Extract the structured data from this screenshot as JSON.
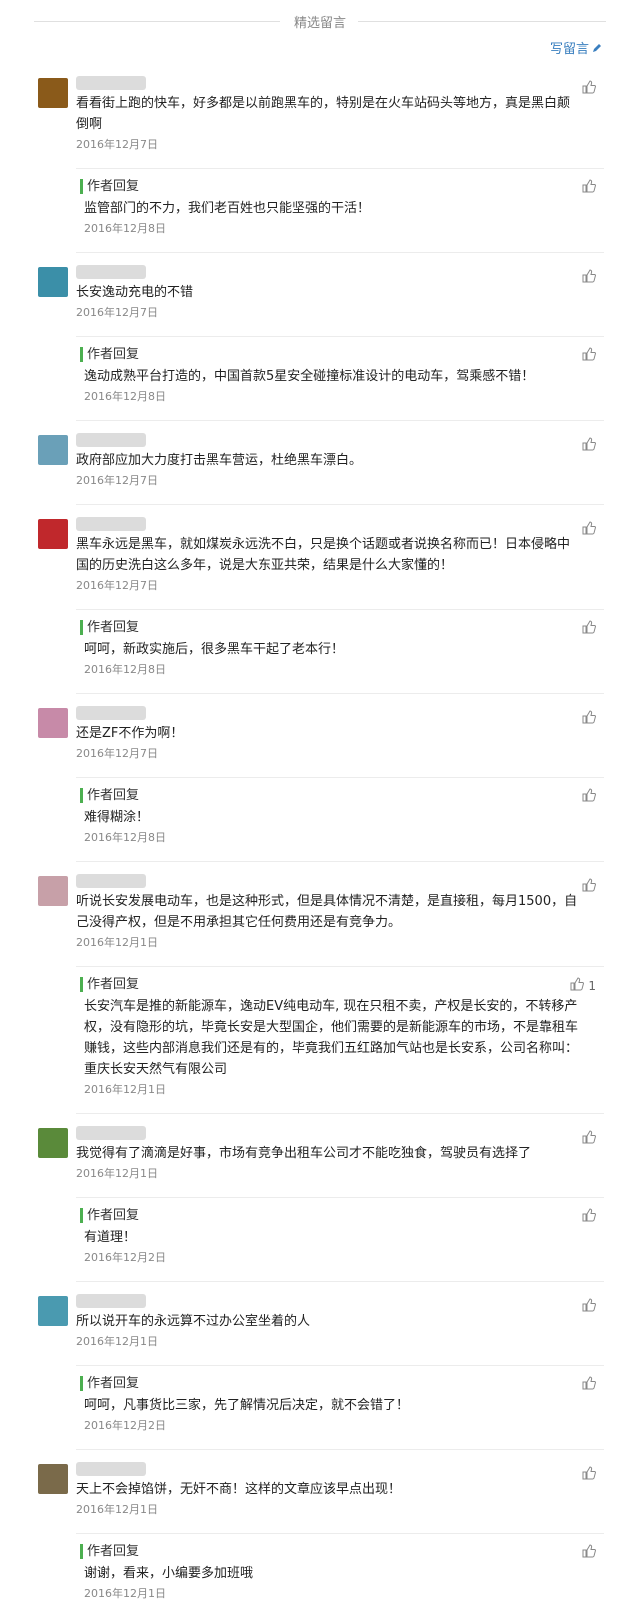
{
  "header": {
    "title": "精选留言",
    "write_label": "写留言"
  },
  "reply_title": "作者回复",
  "comments": [
    {
      "content": "看看街上跑的快车，好多都是以前跑黑车的，特别是在火车站码头等地方，真是黑白颠倒啊",
      "date": "2016年12月7日",
      "avatar_color": "#8a5a1a",
      "reply": {
        "content": "监管部门的不力，我们老百姓也只能坚强的干活！",
        "date": "2016年12月8日"
      }
    },
    {
      "content": "长安逸动充电的不错",
      "date": "2016年12月7日",
      "avatar_color": "#3b8fa8",
      "reply": {
        "content": "逸动成熟平台打造的，中国首款5星安全碰撞标准设计的电动车，驾乘感不错！",
        "date": "2016年12月8日"
      }
    },
    {
      "content": "政府部应加大力度打击黑车营运，杜绝黑车漂白。",
      "date": "2016年12月7日",
      "avatar_color": "#6aa0b8",
      "reply": null
    },
    {
      "content": "黑车永远是黑车，就如煤炭永远洗不白，只是换个话题或者说换名称而已！日本侵略中国的历史洗白这么多年，说是大东亚共荣，结果是什么大家懂的！",
      "date": "2016年12月7日",
      "avatar_color": "#c0282c",
      "reply": {
        "content": "呵呵，新政实施后，很多黑车干起了老本行！",
        "date": "2016年12月8日"
      }
    },
    {
      "content": "还是ZF不作为啊！",
      "date": "2016年12月7日",
      "avatar_color": "#c78aa8",
      "reply": {
        "content": "难得糊涂！",
        "date": "2016年12月8日"
      }
    },
    {
      "content": "听说长安发展电动车，也是这种形式，但是具体情况不清楚，是直接租，每月1500，自己没得产权，但是不用承担其它任何费用还是有竞争力。",
      "date": "2016年12月1日",
      "avatar_color": "#c7a0a8",
      "reply": {
        "content": "长安汽车是推的新能源车，逸动EV纯电动车, 现在只租不卖，产权是长安的，不转移产权，没有隐形的坑，毕竟长安是大型国企，他们需要的是新能源车的市场，不是靠租车赚钱，这些内部消息我们还是有的，毕竟我们五红路加气站也是长安系，公司名称叫：重庆长安天然气有限公司",
        "date": "2016年12月1日",
        "likes": "1"
      }
    },
    {
      "content": "我觉得有了滴滴是好事，市场有竞争出租车公司才不能吃独食，驾驶员有选择了",
      "date": "2016年12月1日",
      "avatar_color": "#5a8a3a",
      "reply": {
        "content": "有道理！",
        "date": "2016年12月2日"
      }
    },
    {
      "content": "所以说开车的永远算不过办公室坐着的人",
      "date": "2016年12月1日",
      "avatar_color": "#4a9ab0",
      "reply": {
        "content": "呵呵，凡事货比三家，先了解情况后决定，就不会错了！",
        "date": "2016年12月2日"
      }
    },
    {
      "content": "天上不会掉馅饼，无奸不商！这样的文章应该早点出现！",
      "date": "2016年12月1日",
      "avatar_color": "#7a6a4a",
      "reply": {
        "content": "谢谢，看来，小编要多加班哦",
        "date": "2016年12月1日"
      }
    }
  ]
}
